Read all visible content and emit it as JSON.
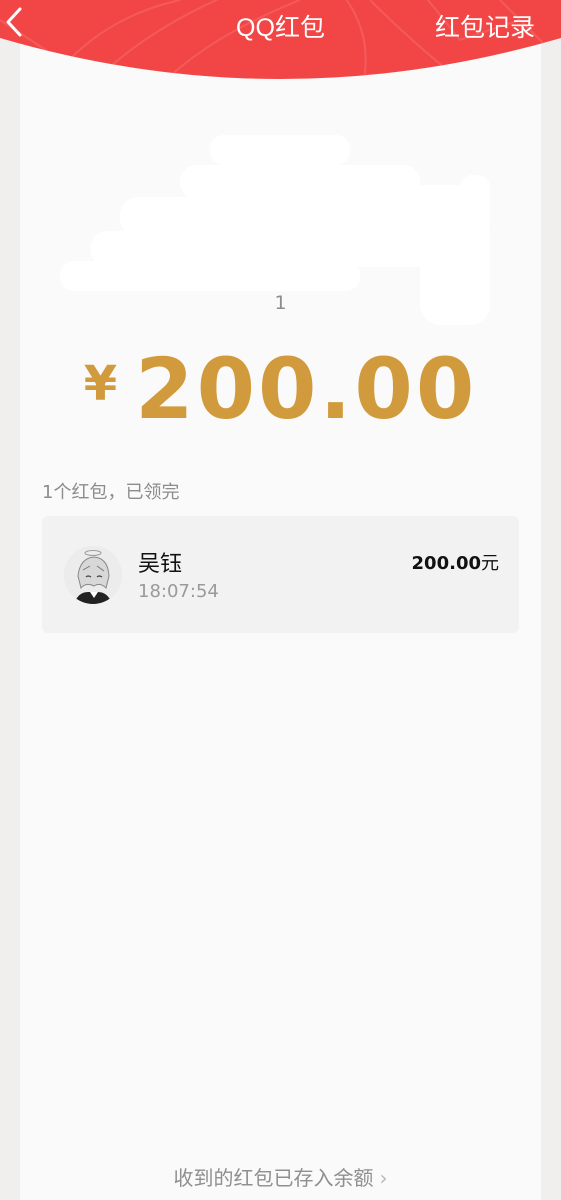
{
  "header": {
    "title": "QQ红包",
    "records_label": "红包记录",
    "back_icon": "chevron-left-icon",
    "background_color": "#f24646"
  },
  "envelope": {
    "subtitle": "1",
    "currency_symbol": "¥",
    "amount": "200.00",
    "amount_color": "#d19b3d"
  },
  "summary": "1个红包，已领完",
  "records": [
    {
      "name": "吴钰",
      "time": "18:07:54",
      "amount": "200.00",
      "unit": "元",
      "avatar_icon": "anime-character-avatar"
    }
  ],
  "footer": {
    "text": "收到的红包已存入余额",
    "chevron": "›"
  }
}
